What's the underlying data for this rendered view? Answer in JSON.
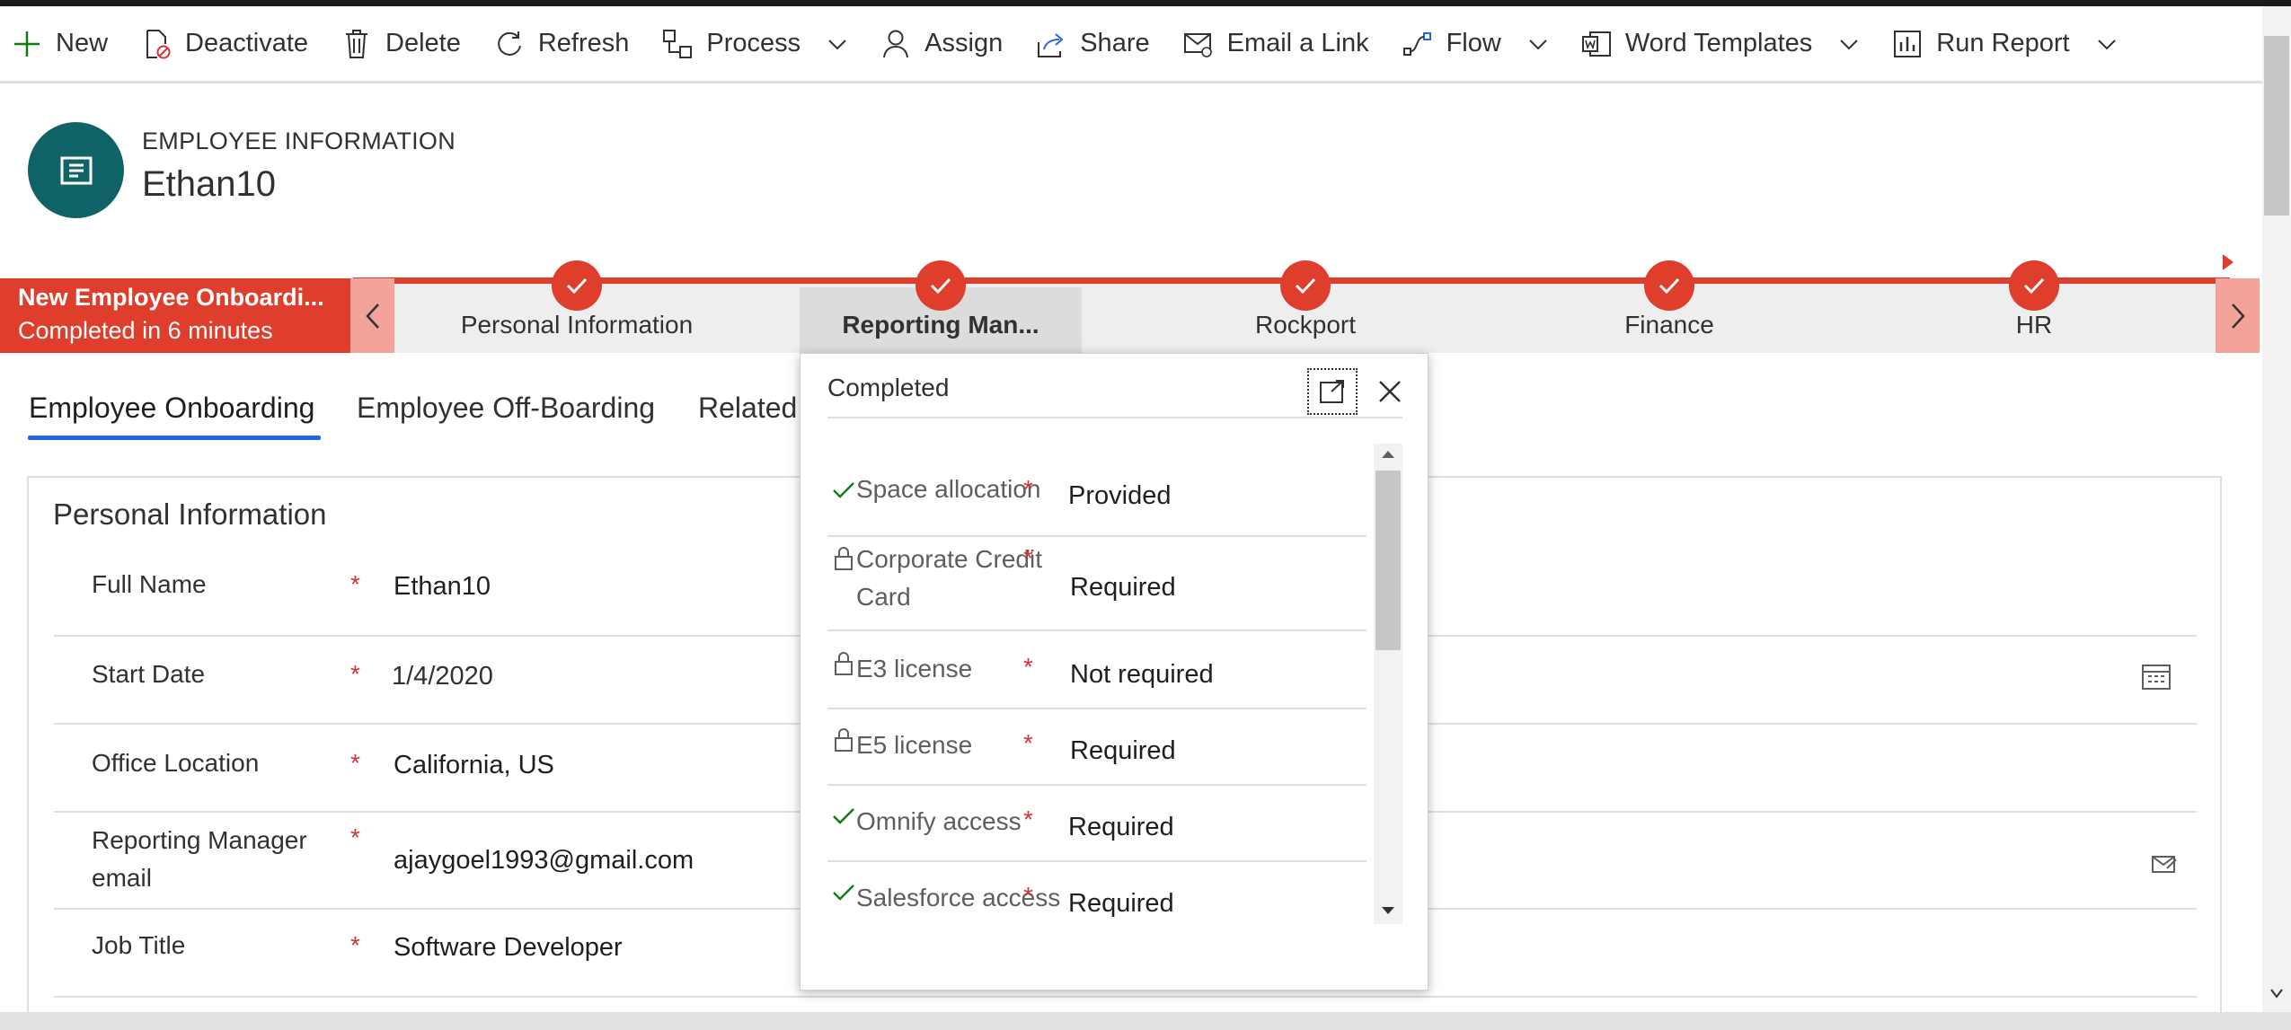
{
  "commands": [
    {
      "label": "New",
      "icon": "plus-icon",
      "dropdown": false
    },
    {
      "label": "Deactivate",
      "icon": "deactivate-icon",
      "dropdown": false
    },
    {
      "label": "Delete",
      "icon": "trash-icon",
      "dropdown": false
    },
    {
      "label": "Refresh",
      "icon": "refresh-icon",
      "dropdown": false
    },
    {
      "label": "Process",
      "icon": "process-icon",
      "dropdown": true
    },
    {
      "label": "Assign",
      "icon": "person-icon",
      "dropdown": false
    },
    {
      "label": "Share",
      "icon": "share-icon",
      "dropdown": false
    },
    {
      "label": "Email a Link",
      "icon": "email-link-icon",
      "dropdown": false
    },
    {
      "label": "Flow",
      "icon": "flow-icon",
      "dropdown": true
    },
    {
      "label": "Word Templates",
      "icon": "word-icon",
      "dropdown": true
    },
    {
      "label": "Run Report",
      "icon": "report-icon",
      "dropdown": true
    }
  ],
  "header": {
    "entity_type": "EMPLOYEE INFORMATION",
    "record_name": "Ethan10"
  },
  "bpf": {
    "process_name": "New Employee Onboardi...",
    "status": "Completed in 6 minutes",
    "stages": [
      {
        "label": "Personal Information",
        "active": false
      },
      {
        "label": "Reporting Man...",
        "active": true
      },
      {
        "label": "Rockport",
        "active": false
      },
      {
        "label": "Finance",
        "active": false
      },
      {
        "label": "HR",
        "active": false
      }
    ],
    "accent_color": "#e03e2d"
  },
  "tabs": [
    {
      "label": "Employee Onboarding",
      "active": true
    },
    {
      "label": "Employee Off-Boarding",
      "active": false
    },
    {
      "label": "Related",
      "active": false
    }
  ],
  "section": {
    "title": "Personal Information",
    "fields": [
      {
        "label": "Full Name",
        "value": "Ethan10"
      },
      {
        "label": "Start Date",
        "value": "1/4/2020"
      },
      {
        "label": "Office Location",
        "value": "California, US"
      },
      {
        "label": "Reporting Manager email",
        "value": "ajaygoel1993@gmail.com"
      },
      {
        "label": "Job Title",
        "value": "Software Developer"
      }
    ],
    "required_mark": "*"
  },
  "flyout": {
    "title": "Completed",
    "steps": [
      {
        "label": "Space allocation",
        "status_icon": "check-icon",
        "value": "Provided"
      },
      {
        "label": "Corporate Credit Card",
        "status_icon": "lock-icon",
        "value": "Required"
      },
      {
        "label": "E3 license",
        "status_icon": "lock-icon",
        "value": "Not required"
      },
      {
        "label": "E5 license",
        "status_icon": "lock-icon",
        "value": "Required"
      },
      {
        "label": "Omnify access",
        "status_icon": "check-icon",
        "value": "Required"
      },
      {
        "label": "Salesforce access",
        "status_icon": "check-icon",
        "value": "Required"
      }
    ]
  }
}
